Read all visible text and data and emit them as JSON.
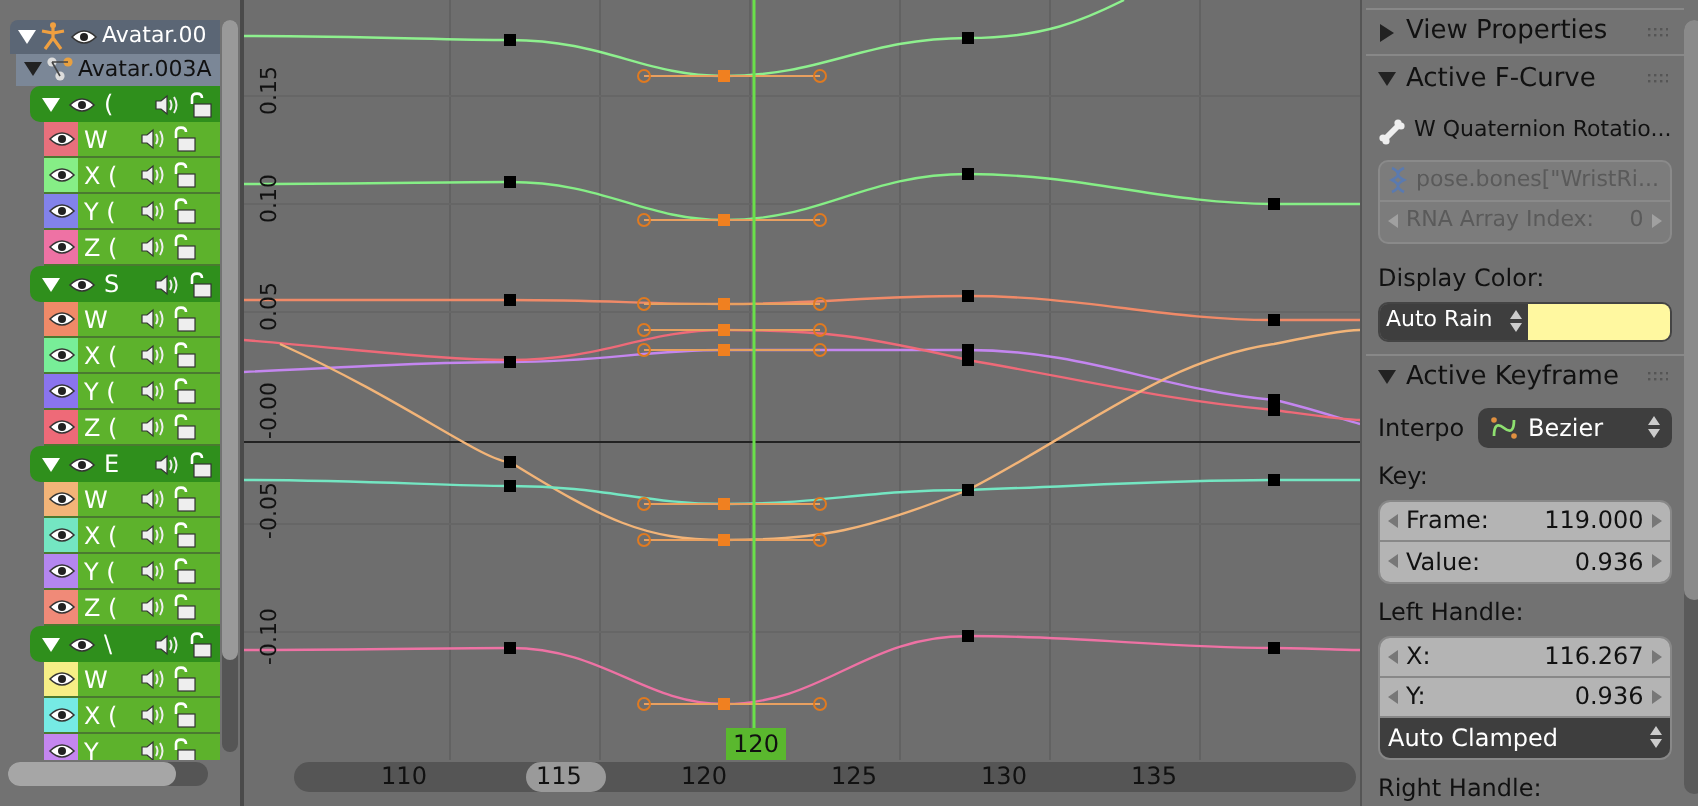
{
  "channels": {
    "armature": {
      "name": "Avatar.00",
      "expanded": true
    },
    "action": {
      "name": "Avatar.003A",
      "expanded": true
    },
    "groups": [
      {
        "name": "(",
        "expanded": true,
        "channels": [
          {
            "name": "W",
            "color": "#e8707c"
          },
          {
            "name": "X (",
            "color": "#86ee86"
          },
          {
            "name": "Y (",
            "color": "#8282ea"
          },
          {
            "name": "Z (",
            "color": "#ee72a4"
          }
        ]
      },
      {
        "name": "S",
        "expanded": true,
        "channels": [
          {
            "name": "W",
            "color": "#f08a68"
          },
          {
            "name": "X (",
            "color": "#78ee98"
          },
          {
            "name": "Y (",
            "color": "#8a74ee"
          },
          {
            "name": "Z (",
            "color": "#ee6a78"
          }
        ]
      },
      {
        "name": "E",
        "expanded": true,
        "channels": [
          {
            "name": "W",
            "color": "#f2b478"
          },
          {
            "name": "X (",
            "color": "#74e6c2"
          },
          {
            "name": "Y (",
            "color": "#b486f0"
          },
          {
            "name": "Z (",
            "color": "#f08a78"
          }
        ]
      },
      {
        "name": "\\",
        "expanded": true,
        "channels": [
          {
            "name": "W",
            "color": "#f6ee86"
          },
          {
            "name": "X (",
            "color": "#76eae4"
          },
          {
            "name": "Y",
            "color": "#c486f0"
          }
        ]
      }
    ]
  },
  "graph": {
    "y_ticks": [
      "0.15",
      "0.10",
      "0.05",
      "-0.00",
      "-0.05",
      "-0.10"
    ],
    "current_frame": "120",
    "x_ticks": [
      {
        "label": "110",
        "kind": "label"
      },
      {
        "label": "115",
        "kind": "thumb"
      },
      {
        "label": "120",
        "kind": "label"
      },
      {
        "label": "125",
        "kind": "label"
      },
      {
        "label": "130",
        "kind": "label"
      },
      {
        "label": "135",
        "kind": "label"
      }
    ]
  },
  "properties": {
    "view_properties": {
      "title": "View Properties",
      "expanded": false
    },
    "active_fcurve": {
      "title": "Active F-Curve",
      "expanded": true,
      "name": "W Quaternion Rotatio...",
      "path": "pose.bones[\"WristRi...",
      "disabled": true,
      "array_index": {
        "label": "RNA Array Index:",
        "value": "0"
      },
      "display_color": {
        "label": "Display Color:",
        "mode": "Auto Rain",
        "color": "#fff8a0"
      }
    },
    "active_keyframe": {
      "title": "Active Keyframe",
      "expanded": true,
      "interpolation": {
        "label": "Interpo",
        "value": "Bezier"
      },
      "key": {
        "label": "Key:",
        "fields": [
          {
            "label": "Frame:",
            "value": "119.000"
          },
          {
            "label": "Value:",
            "value": "0.936"
          }
        ]
      },
      "left_handle": {
        "label": "Left Handle:",
        "fields": [
          {
            "label": "X:",
            "value": "116.267"
          },
          {
            "label": "Y:",
            "value": "0.936"
          }
        ],
        "type": "Auto Clamped"
      },
      "right_handle": {
        "label": "Right Handle:"
      }
    }
  }
}
